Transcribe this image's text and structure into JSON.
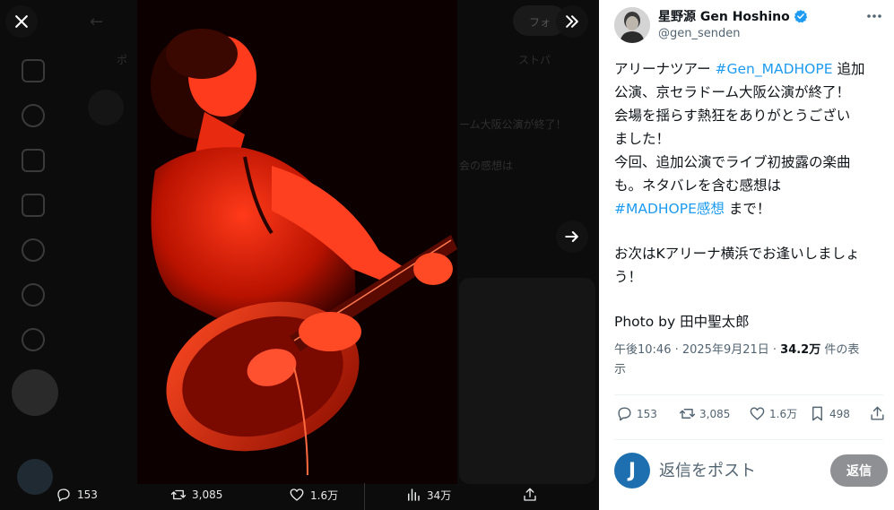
{
  "viewer": {
    "close_icon": "close-icon",
    "collapse_icon": "double-chevron-right-icon",
    "next_icon": "arrow-right-icon",
    "background_hint": {
      "follow_label": "フォ",
      "tab_label": "ポ",
      "right_hint": "ストパ",
      "line1": "ーム大阪公演が終了！",
      "line2": "会の感想は"
    },
    "actions": {
      "replies": "153",
      "reposts": "3,085",
      "likes": "1.6万",
      "views": "34万"
    }
  },
  "tweet": {
    "author": {
      "name": "星野源 Gen Hoshino",
      "handle": "@gen_senden",
      "verified_color": "#1d9bf0"
    },
    "text": {
      "l1_pre": "アリーナツアー ",
      "l1_tag": "#Gen_MADHOPE",
      "l1_post": " 追加",
      "l2": "公演、京セラドーム大阪公演が終了！",
      "l3": "会場を揺らす熱狂をありがとうござい",
      "l4": "ました！",
      "l5": "今回、追加公演でライブ初披露の楽曲",
      "l6": "も。ネタバレを含む感想は",
      "l7_tag": "#MADHOPE感想",
      "l7_post": " まで！",
      "l8": "お次はKアリーナ横浜でお逢いしましょ",
      "l9": "う！",
      "l10": "Photo by 田中聖太郎"
    },
    "meta": {
      "datetime": "午後10:46 · 2025年9月21日 · ",
      "views_count": "34.2万",
      "views_suffix": " 件の表",
      "views_suffix2": "示"
    },
    "actions": {
      "replies": "153",
      "reposts": "3,085",
      "likes": "1.6万",
      "bookmarks": "498"
    },
    "reply": {
      "avatar_letter": "J",
      "placeholder": "返信をポスト",
      "button": "返信"
    },
    "colors": {
      "link": "#1d9bf0",
      "text": "#0f1419",
      "muted": "#536471"
    }
  }
}
